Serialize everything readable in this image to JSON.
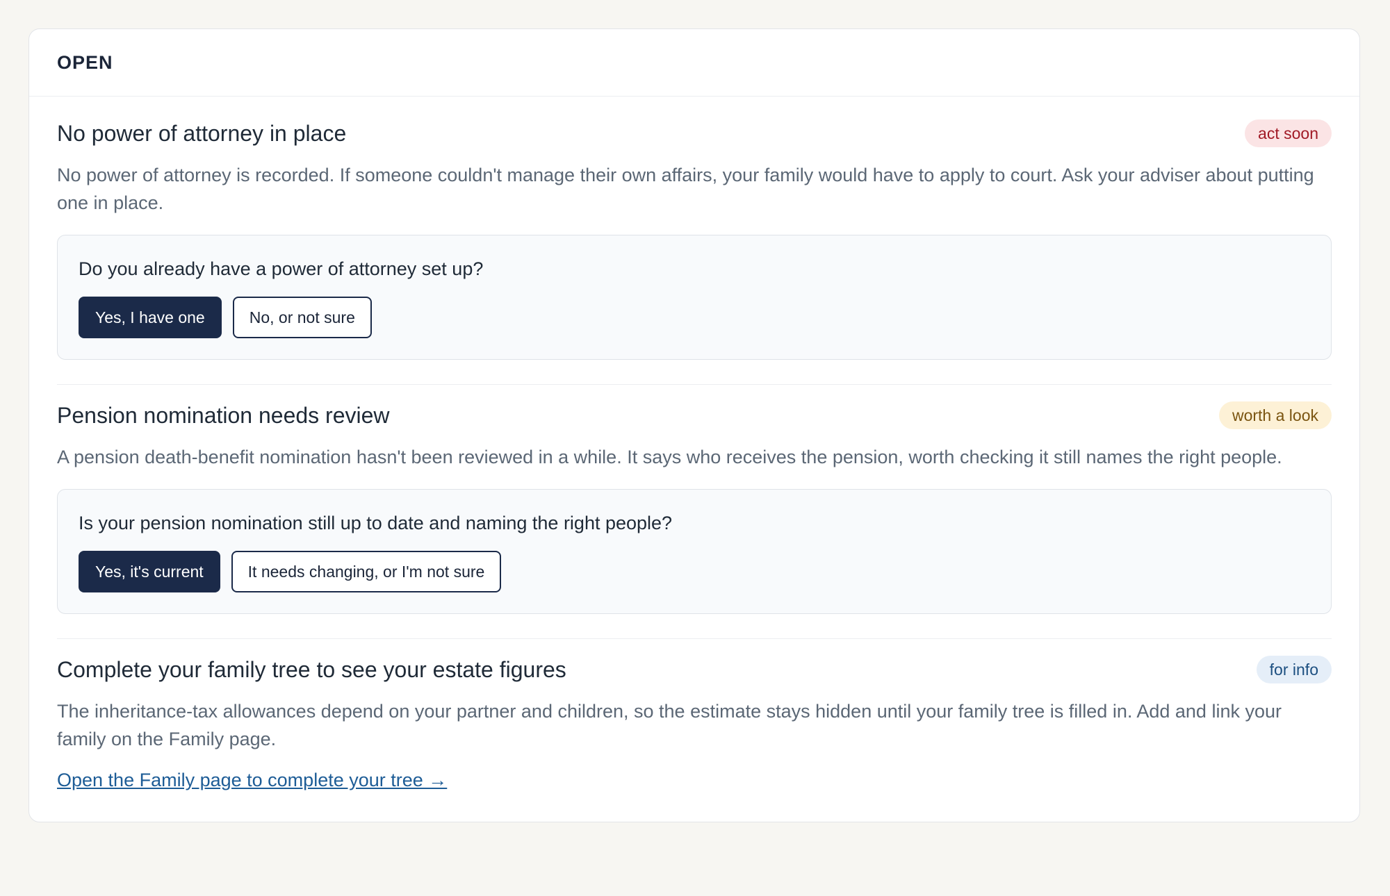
{
  "card": {
    "title": "OPEN"
  },
  "items": [
    {
      "title": "No power of attorney in place",
      "badge": "act soon",
      "body": "No power of attorney is recorded. If someone couldn't manage their own affairs, your family would have to apply to court. Ask your adviser about putting one in place.",
      "question": "Do you already have a power of attorney set up?",
      "yes_label": "Yes, I have one",
      "no_label": "No, or not sure"
    },
    {
      "title": "Pension nomination needs review",
      "badge": "worth a look",
      "body": "A pension death-benefit nomination hasn't been reviewed in a while. It says who receives the pension, worth checking it still names the right people.",
      "question": "Is your pension nomination still up to date and naming the right people?",
      "yes_label": "Yes, it's current",
      "no_label": "It needs changing, or I'm not sure"
    },
    {
      "title": "Complete your family tree to see your estate figures",
      "badge": "for info",
      "body": "The inheritance-tax allowances depend on your partner and children, so the estimate stays hidden until your family tree is filled in. Add and link your family on the Family page.",
      "link": "Open the Family page to complete your tree →"
    }
  ],
  "colors": {
    "primary_button": "#1b2a49",
    "badge_act_soon_bg": "#fbe4e5",
    "badge_worth_a_look_bg": "#fdf1d6",
    "badge_for_info_bg": "#e5eef8",
    "link": "#1d5c96"
  }
}
